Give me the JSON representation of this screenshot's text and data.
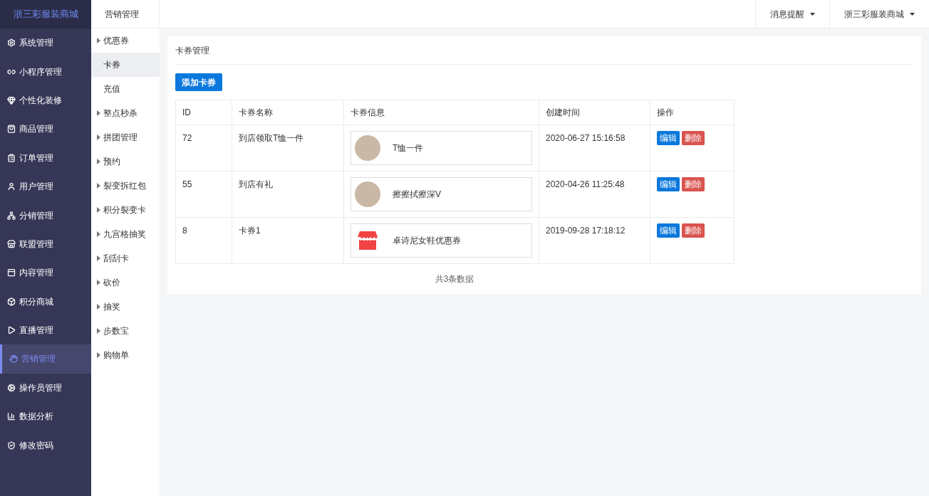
{
  "brand": "浙三彩服装商城",
  "sidebar": {
    "items": [
      {
        "label": "系统管理",
        "selected": false
      },
      {
        "label": "小程序管理",
        "selected": false
      },
      {
        "label": "个性化装修",
        "selected": false
      },
      {
        "label": "商品管理",
        "selected": false
      },
      {
        "label": "订单管理",
        "selected": false
      },
      {
        "label": "用户管理",
        "selected": false
      },
      {
        "label": "分销管理",
        "selected": false
      },
      {
        "label": "联盟管理",
        "selected": false
      },
      {
        "label": "内容管理",
        "selected": false
      },
      {
        "label": "积分商城",
        "selected": false
      },
      {
        "label": "直播管理",
        "selected": false
      },
      {
        "label": "营销管理",
        "selected": true
      },
      {
        "label": "操作员管理",
        "selected": false
      },
      {
        "label": "数据分析",
        "selected": false
      },
      {
        "label": "修改密码",
        "selected": false
      }
    ]
  },
  "submenu": {
    "title": "营销管理",
    "items": [
      {
        "label": "优惠券",
        "expandable": true,
        "selected": false
      },
      {
        "label": "卡券",
        "expandable": false,
        "selected": true
      },
      {
        "label": "充值",
        "expandable": false,
        "selected": false
      },
      {
        "label": "整点秒杀",
        "expandable": true,
        "selected": false
      },
      {
        "label": "拼团管理",
        "expandable": true,
        "selected": false
      },
      {
        "label": "预约",
        "expandable": true,
        "selected": false
      },
      {
        "label": "裂变拆红包",
        "expandable": true,
        "selected": false
      },
      {
        "label": "积分裂变卡",
        "expandable": true,
        "selected": false
      },
      {
        "label": "九宫格抽奖",
        "expandable": true,
        "selected": false
      },
      {
        "label": "刮刮卡",
        "expandable": true,
        "selected": false
      },
      {
        "label": "砍价",
        "expandable": true,
        "selected": false
      },
      {
        "label": "抽奖",
        "expandable": true,
        "selected": false
      },
      {
        "label": "步数宝",
        "expandable": true,
        "selected": false
      },
      {
        "label": "购物单",
        "expandable": true,
        "selected": false
      }
    ]
  },
  "header_menus": [
    "消息提醒",
    "浙三彩服装商城"
  ],
  "panel": {
    "title": "卡券管理",
    "add_button": "添加卡券",
    "table": {
      "columns": [
        "ID",
        "卡券名称",
        "卡券信息",
        "创建时间",
        "操作"
      ],
      "rows": [
        {
          "id": "72",
          "name": "到店领取T恤一件",
          "info": {
            "kind": "photo",
            "text": "T恤一件"
          },
          "created": "2020-06-27 15:16:58",
          "edit": "编辑",
          "delete": "删除"
        },
        {
          "id": "55",
          "name": "到店有礼",
          "info": {
            "kind": "photo",
            "text": "擦擦拭擦深V"
          },
          "created": "2020-04-26 11:25:48",
          "edit": "编辑",
          "delete": "删除"
        },
        {
          "id": "8",
          "name": "卡券1",
          "info": {
            "kind": "shop",
            "text": "卓诗尼女鞋优惠券"
          },
          "created": "2019-09-28 17:18:12",
          "edit": "编辑",
          "delete": "删除"
        }
      ]
    },
    "footer": "共3条数据"
  }
}
